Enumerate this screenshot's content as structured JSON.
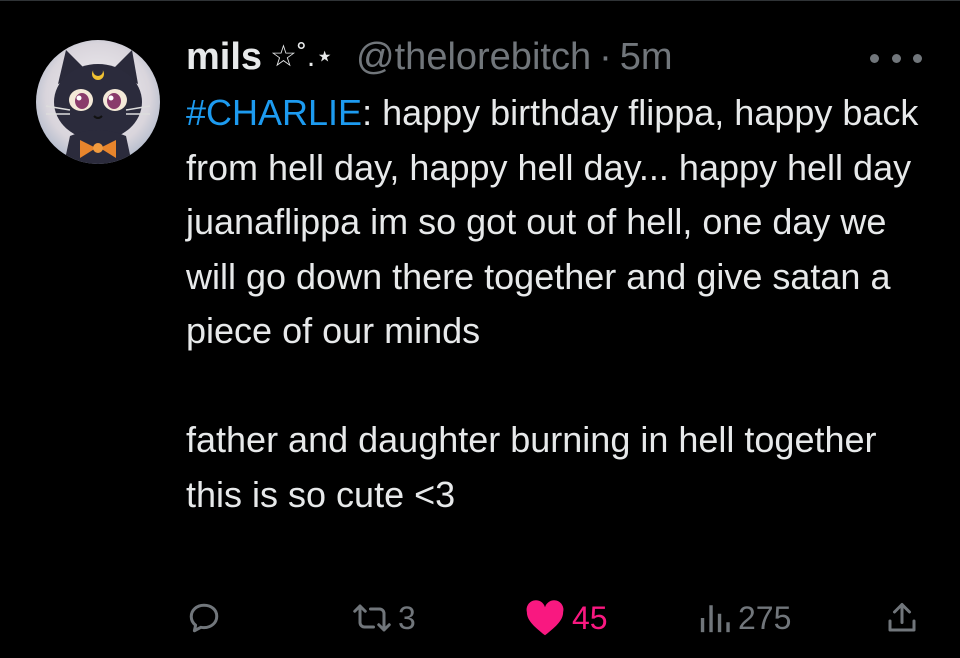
{
  "tweet": {
    "author": {
      "display_name": "mils",
      "name_decoration": "☆˚.⋆",
      "handle": "@thelorebitch",
      "separator": "·",
      "timestamp": "5m"
    },
    "body": {
      "hashtag": "#CHARLIE",
      "paragraph1_rest": ": happy birthday flippa, happy back from hell day, happy hell day... happy hell day juanaflippa im so got out of hell, one day we will go down there together and give satan a piece of our minds",
      "paragraph2": "father and daughter burning in hell together this is so cute <3"
    },
    "actions": {
      "reply": {
        "icon": "reply-icon",
        "count": ""
      },
      "retweet": {
        "icon": "retweet-icon",
        "count": "3"
      },
      "like": {
        "icon": "heart-icon",
        "count": "45",
        "liked": true
      },
      "views": {
        "icon": "views-icon",
        "count": "275"
      },
      "share": {
        "icon": "share-icon"
      }
    }
  },
  "colors": {
    "background": "#000000",
    "text": "#e7e9ea",
    "muted": "#71767b",
    "link": "#1d9bf0",
    "like": "#f91880"
  }
}
